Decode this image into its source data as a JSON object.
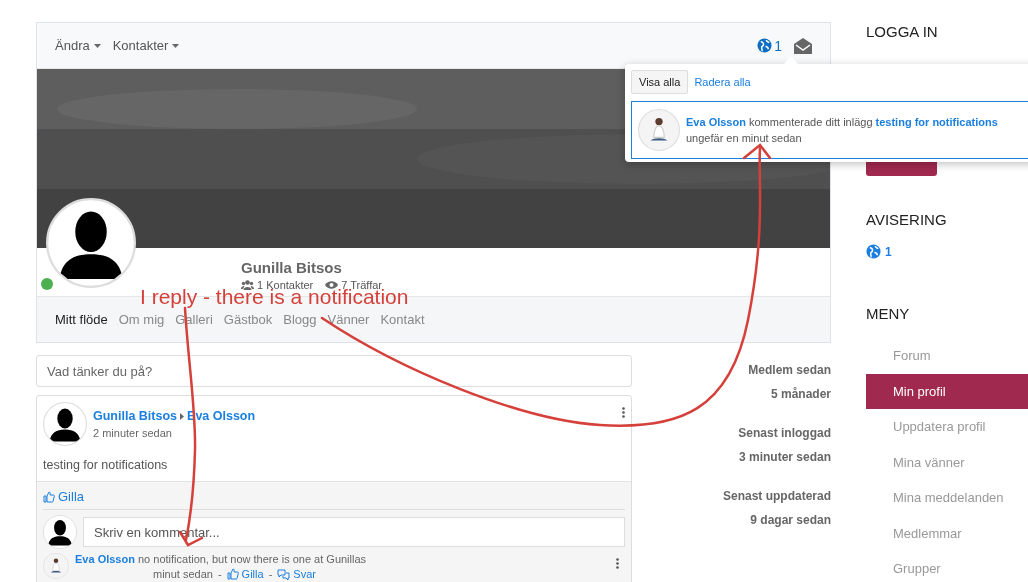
{
  "navbar": {
    "menus": [
      {
        "label": "Ändra"
      },
      {
        "label": "Kontakter"
      }
    ],
    "notification_count": "1"
  },
  "notifications": {
    "show_all": "Visa alla",
    "clear_all": "Radera alla",
    "items": [
      {
        "author": "Eva Olsson",
        "text": "kommenterade ditt inlägg",
        "link": "testing for notifications",
        "time": "ungefär en minut sedan"
      }
    ]
  },
  "profile": {
    "name": "Gunilla Bitsos",
    "online": true,
    "contacts": "1 Kontakter",
    "views": "7 Träffar",
    "tabs": [
      {
        "label": "Mitt flöde",
        "selected": true
      },
      {
        "label": "Om mig",
        "selected": false
      },
      {
        "label": "Galleri",
        "selected": false
      },
      {
        "label": "Gästbok",
        "selected": false
      },
      {
        "label": "Blogg",
        "selected": false
      },
      {
        "label": "Vänner",
        "selected": false
      },
      {
        "label": "Kontakt",
        "selected": false
      }
    ]
  },
  "post_box": {
    "placeholder": "Vad tänker du på?"
  },
  "post": {
    "author": "Gunilla Bitsos",
    "recipient": "Eva Olsson",
    "time": "2 minuter sedan",
    "body": "testing for notifications",
    "like": "Gilla",
    "comment_placeholder": "Skriv en kommentar...",
    "comments": [
      {
        "author": "Eva Olsson",
        "text": "no notification, but now there is one at Gunillas",
        "time": "minut sedan",
        "separator": "-",
        "like": "Gilla",
        "reply": "Svar"
      }
    ]
  },
  "stats": [
    {
      "label": "Medlem sedan",
      "value": "5 månader"
    },
    {
      "label": "Senast inloggad",
      "value": "3 minuter sedan"
    },
    {
      "label": "Senast uppdaterad",
      "value": "9 dagar sedan"
    }
  ],
  "sidebar": {
    "login_title": "LOGGA IN",
    "notice_title": "AVISERING",
    "notice_count": "1",
    "menu_title": "MENY",
    "menu": [
      {
        "label": "Forum",
        "selected": false
      },
      {
        "label": "Min profil",
        "selected": true
      },
      {
        "label": "Uppdatera profil",
        "selected": false
      },
      {
        "label": "Mina vänner",
        "selected": false
      },
      {
        "label": "Mina meddelanden",
        "selected": false
      },
      {
        "label": "Medlemmar",
        "selected": false
      },
      {
        "label": "Grupper",
        "selected": false
      }
    ]
  },
  "annotation": {
    "text": "I reply - there is a notification"
  }
}
